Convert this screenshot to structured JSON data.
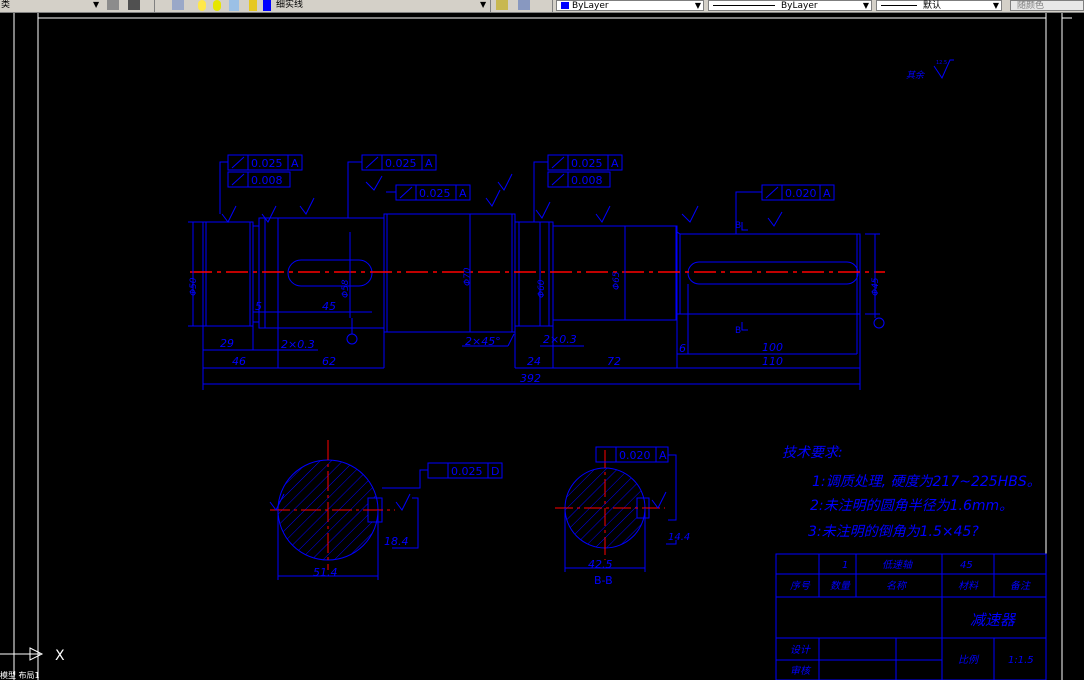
{
  "toolbar": {
    "left_text": "类",
    "linetype_label": "细实线",
    "color_dropdown": "ByLayer",
    "linetype_dropdown": "ByLayer",
    "lineweight_dropdown": "默认",
    "plotstyle_dropdown": "随颜色"
  },
  "drawing": {
    "roughness_note": "其余",
    "roughness_value": "12.5",
    "tolerances": {
      "runout_1": "0.025",
      "runout_1_datum": "A",
      "cyl_1": "0.008",
      "runout_2": "0.025",
      "runout_2_datum": "A",
      "runout_3": "0.025",
      "runout_3_datum": "A",
      "runout_4": "0.025",
      "runout_4_datum": "A",
      "cyl_2": "0.008",
      "runout_5": "0.020",
      "runout_5_datum": "A",
      "sym_c": "0.025",
      "sym_c_datum": "D",
      "sym_b": "0.020",
      "sym_b_datum": "A"
    },
    "dims": {
      "d29": "29",
      "d46": "46",
      "d5": "5",
      "d45": "45",
      "d2x03a": "2×0.3",
      "d62": "62",
      "d2x45": "2×45°",
      "d24": "24",
      "d2x03b": "2×0.3",
      "d72": "72",
      "d6": "6",
      "d100": "100",
      "d110": "110",
      "d392": "392",
      "dia50": "Φ50",
      "dia58": "Φ58",
      "dia70": "Φ70",
      "dia60": "Φ60",
      "dia65": "Φ65",
      "dia45": "Φ45",
      "cs_c_w": "51.4",
      "cs_c_key": "18.4",
      "cs_b_w": "42.5",
      "cs_b_key": "14.4",
      "section_b_label": "B-B",
      "section_marker": "B"
    },
    "tech": {
      "title": "技术要求:",
      "line1": "1:调质处理, 硬度为217~225HBS。",
      "line2": "2:未注明的圆角半径为1.6mm。",
      "line3": "3:未注明的倒角为1.5×45?"
    },
    "titleblock": {
      "qty": "1",
      "part_name": "低速轴",
      "material": "45",
      "h_seq": "序号",
      "h_qty": "数量",
      "h_name": "名称",
      "h_material": "材料",
      "h_remark": "备注",
      "assembly": "减速器",
      "design_label": "设计",
      "check_label": "审核",
      "scale_label": "比例",
      "scale_value": "1:1.5"
    },
    "ucs_x": "X"
  },
  "cmdline": {
    "text": "模型 布局1"
  },
  "colors": {
    "background": "#000000",
    "geometry": "#0000ff",
    "centerline": "#ff0000",
    "border": "#ffffff",
    "toolbar": "#d4d0c8"
  }
}
